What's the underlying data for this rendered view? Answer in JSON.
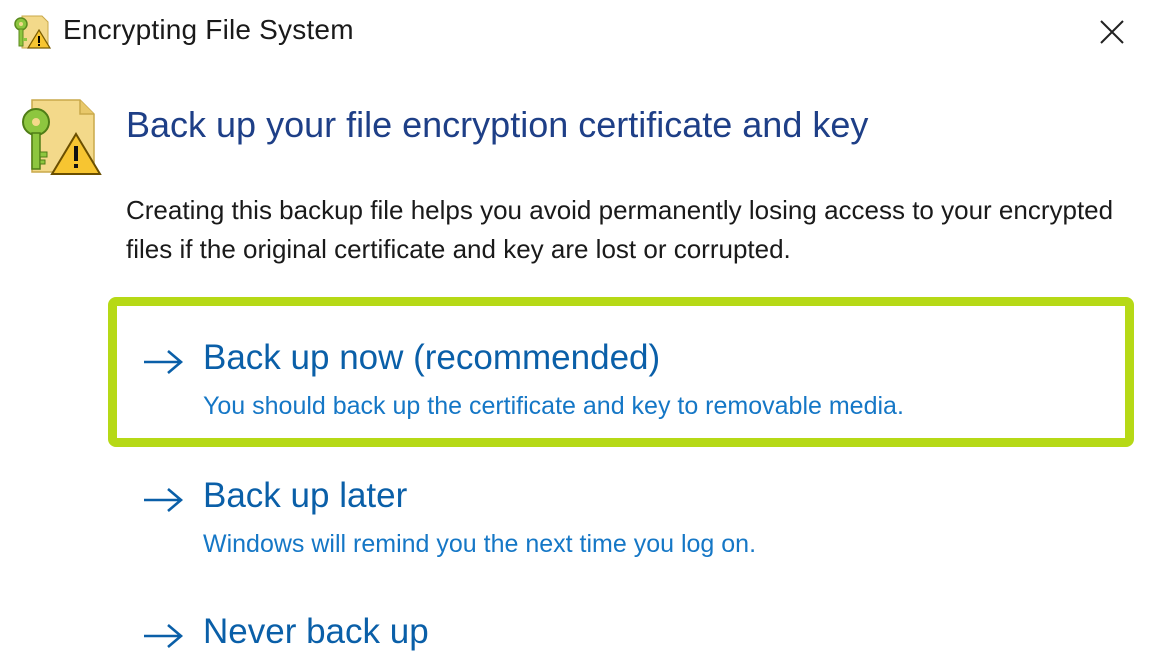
{
  "window": {
    "title": "Encrypting File System",
    "icon": "key-certificate-warning-icon",
    "close_icon": "close-icon"
  },
  "header": {
    "heading": "Back up your file encryption certificate and key",
    "description": "Creating this backup file helps you avoid permanently losing access to your encrypted files if the original certificate and key are lost or corrupted."
  },
  "options": [
    {
      "title": "Back up now (recommended)",
      "subtitle": "You should back up the certificate and key to removable media.",
      "highlighted": true
    },
    {
      "title": "Back up later",
      "subtitle": "Windows will remind you the next time you log on."
    },
    {
      "title": "Never back up"
    }
  ],
  "colors": {
    "heading": "#1e3f87",
    "link": "#0a5fa8",
    "highlight_border": "#b6d916"
  }
}
